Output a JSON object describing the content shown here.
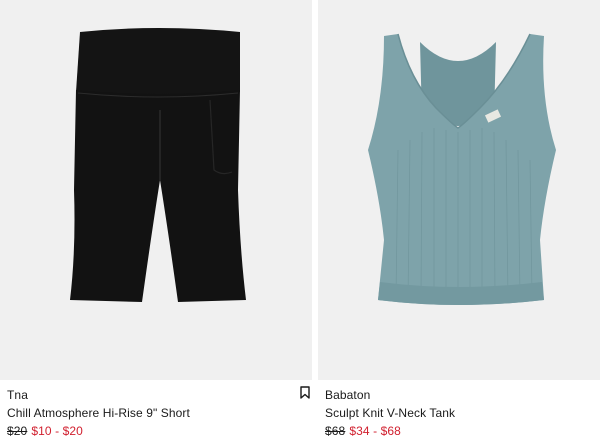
{
  "products": [
    {
      "brand": "Tna",
      "name": "Chill Atmosphere Hi-Rise 9\" Short",
      "price_original": "$20",
      "price_sale": "$10 - $20",
      "image_icon": "bike-shorts-image",
      "garment_color": "#121212"
    },
    {
      "brand": "Babaton",
      "name": "Sculpt Knit V-Neck Tank",
      "price_original": "$68",
      "price_sale": "$34 - $68",
      "image_icon": "tank-top-image",
      "garment_color": "#7ea3aa"
    }
  ],
  "wishlist_icon": "bookmark-icon",
  "colors": {
    "image_background": "#f0f0f0",
    "sale_price": "#d1202f",
    "text": "#1a1a1a"
  }
}
